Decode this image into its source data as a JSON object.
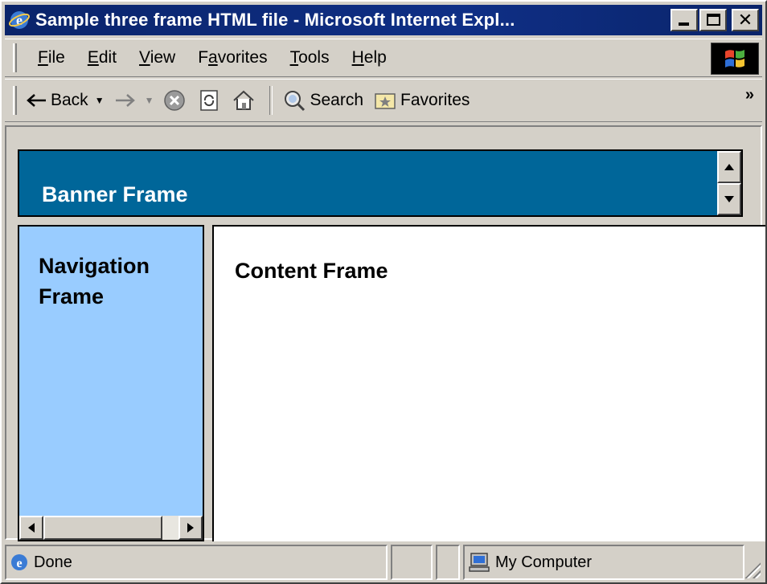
{
  "window": {
    "title": "Sample three frame HTML file - Microsoft Internet Expl...",
    "title_bar_color": "#0a246a"
  },
  "menu": {
    "items": [
      {
        "label": "File",
        "accel_index": 0
      },
      {
        "label": "Edit",
        "accel_index": 0
      },
      {
        "label": "View",
        "accel_index": 0
      },
      {
        "label": "Favorites",
        "accel_index": 1
      },
      {
        "label": "Tools",
        "accel_index": 0
      },
      {
        "label": "Help",
        "accel_index": 0
      }
    ]
  },
  "toolbar": {
    "back_label": "Back",
    "search_label": "Search",
    "favorites_label": "Favorites",
    "more_glyph": "»",
    "icons": [
      "back-arrow-icon",
      "forward-arrow-icon",
      "stop-icon",
      "refresh-icon",
      "home-icon",
      "search-icon",
      "favorites-icon"
    ]
  },
  "frames": {
    "banner": {
      "label": "Banner Frame",
      "bg": "#006699",
      "fg": "#ffffff"
    },
    "navigation": {
      "line1": "Navigation",
      "line2": "Frame",
      "bg": "#99ccff"
    },
    "content": {
      "label": "Content Frame",
      "bg": "#ffffff"
    }
  },
  "status": {
    "text": "Done",
    "zone": "My Computer"
  }
}
